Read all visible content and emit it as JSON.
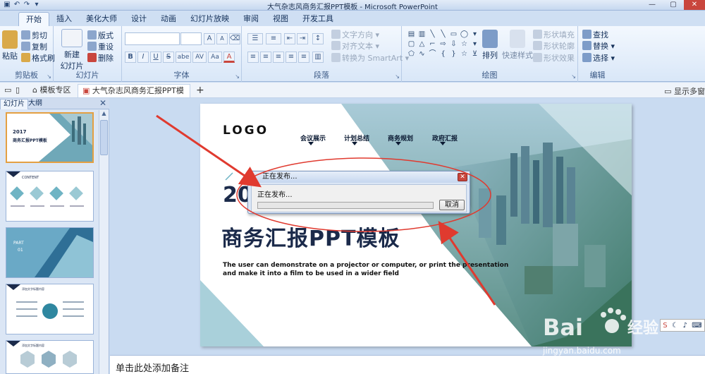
{
  "window": {
    "title": "大气杂志风商务汇报PPT模板 - Microsoft PowerPoint"
  },
  "ribbon_tabs": [
    "开始",
    "插入",
    "美化大师",
    "设计",
    "动画",
    "幻灯片放映",
    "审阅",
    "视图",
    "开发工具"
  ],
  "ribbon": {
    "clipboard": {
      "label": "剪贴板",
      "paste": "粘贴",
      "cut": "剪切",
      "copy": "复制",
      "format_painter": "格式刷"
    },
    "slides": {
      "label": "幻灯片",
      "new_slide_line1": "新建",
      "new_slide_line2": "幻灯片",
      "layout": "版式",
      "reset": "重设",
      "delete": "删除"
    },
    "font": {
      "label": "字体",
      "bold": "B",
      "italic": "I",
      "underline": "U",
      "strike": "S",
      "shadow": "abe",
      "spacing": "AV",
      "case": "Aa",
      "color": "A",
      "grow": "A",
      "shrink": "A"
    },
    "paragraph": {
      "label": "段落",
      "text_direction": "文字方向",
      "align_text": "对齐文本",
      "smartart": "转换为 SmartArt"
    },
    "drawing": {
      "label": "绘图",
      "arrange": "排列",
      "quick_styles": "快速样式",
      "shape_fill": "形状填充",
      "shape_outline": "形状轮廓",
      "shape_effects": "形状效果"
    },
    "editing": {
      "label": "编辑",
      "find": "查找",
      "replace": "替换",
      "select": "选择"
    }
  },
  "doc_tabs": {
    "template_zone": "模板专区",
    "active_doc": "大气杂志风商务汇报PPT模板",
    "show_more": "显示多窗"
  },
  "left_pane": {
    "tab_slides": "幻灯片",
    "tab_outline": "大纲"
  },
  "thumbnails": {
    "t1_year": "2017",
    "t1_title": "商务汇报PPT模板",
    "t2_title": "CONTENT",
    "t3_part": "PART",
    "t3_num": "01",
    "t4_title": "添加文字标题内容",
    "t5_title": "添加文字标题内容"
  },
  "slide": {
    "logo": "LOGO",
    "nav": [
      "会议展示",
      "计划总结",
      "商务规划",
      "政府汇报"
    ],
    "year_visible": "20",
    "title": "商务汇报PPT模板",
    "subtitle_line1": "The user can demonstrate on a projector or computer, or print the presentation",
    "subtitle_line2": "and make it into a film to be used in a wider field"
  },
  "dialog": {
    "title": "正在发布...",
    "message": "正在发布...",
    "cancel": "取消",
    "progress": 0.0
  },
  "notes_placeholder": "单击此处添加备注",
  "watermark": {
    "brand_left": "Bai",
    "brand_right": "经验",
    "url": "jingyan.baidu.com"
  },
  "colors": {
    "annotation_red": "#e03a2f",
    "slide_navy": "#1b2a4a",
    "teal": "#5aa7bb"
  }
}
